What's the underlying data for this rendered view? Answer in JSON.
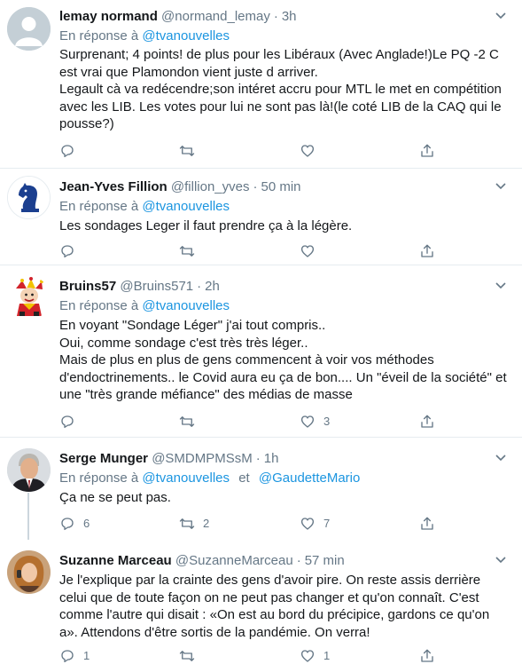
{
  "reply_prefix": "En réponse à",
  "and_word": "et",
  "colors": {
    "accent": "#1b95e0",
    "muted": "#657786",
    "text": "#14171a",
    "border": "#e6ecf0"
  },
  "tweets": [
    {
      "name": "lemay normand",
      "handle": "@normand_lemay",
      "time": "3h",
      "mentions": [
        "@tvanouvelles"
      ],
      "paragraphs": [
        "Surprenant; 4 points! de plus pour les Libéraux (Avec Anglade!)Le PQ -2 C est vrai que Plamondon vient juste d arriver.",
        "Legault cà va redécendre;son intéret accru pour MTL le met en compétition avec les LIB. Les votes pour lui ne sont pas là!(le coté LIB de la CAQ qui le pousse?)"
      ],
      "counts": {
        "reply": "",
        "retweet": "",
        "like": ""
      },
      "avatar_icon": "default-avatar-icon"
    },
    {
      "name": "Jean-Yves Fillion",
      "handle": "@fillion_yves",
      "time": "50 min",
      "mentions": [
        "@tvanouvelles"
      ],
      "paragraphs": [
        "Les sondages Leger il faut prendre ça à la légère."
      ],
      "counts": {
        "reply": "",
        "retweet": "",
        "like": ""
      },
      "avatar_icon": "chess-knight-icon"
    },
    {
      "name": "Bruins57",
      "handle": "@Bruins571",
      "time": "2h",
      "mentions": [
        "@tvanouvelles"
      ],
      "paragraphs": [
        "En voyant \"Sondage Léger\" j'ai tout compris..",
        "Oui, comme sondage c'est très très léger..",
        "Mais de plus en plus de gens commencent à voir vos méthodes d'endoctrinements.. le Covid aura eu ça de bon.... Un \"éveil de la société\" et une \"très grande méfiance\" des médias de masse"
      ],
      "counts": {
        "reply": "",
        "retweet": "",
        "like": "3"
      },
      "avatar_icon": "jester-avatar-icon"
    },
    {
      "name": "Serge Munger",
      "handle": "@SMDMPMSsM",
      "time": "1h",
      "mentions": [
        "@tvanouvelles",
        "@GaudetteMario"
      ],
      "paragraphs": [
        "Ça ne se peut pas."
      ],
      "counts": {
        "reply": "6",
        "retweet": "2",
        "like": "7"
      },
      "avatar_icon": "man-portrait-icon"
    },
    {
      "name": "Suzanne Marceau",
      "handle": "@SuzanneMarceau",
      "time": "57 min",
      "mentions": [],
      "paragraphs": [
        "Je l'explique par la crainte des gens d'avoir pire. On reste assis derrière celui que de toute façon on ne peut pas changer et qu'on connaît. C'est comme l'autre qui disait : «On est au bord du précipice, gardons ce qu'on a». Attendons d'être sortis de la pandémie. On verra!"
      ],
      "counts": {
        "reply": "1",
        "retweet": "",
        "like": "1"
      },
      "avatar_icon": "woman-portrait-icon"
    }
  ]
}
